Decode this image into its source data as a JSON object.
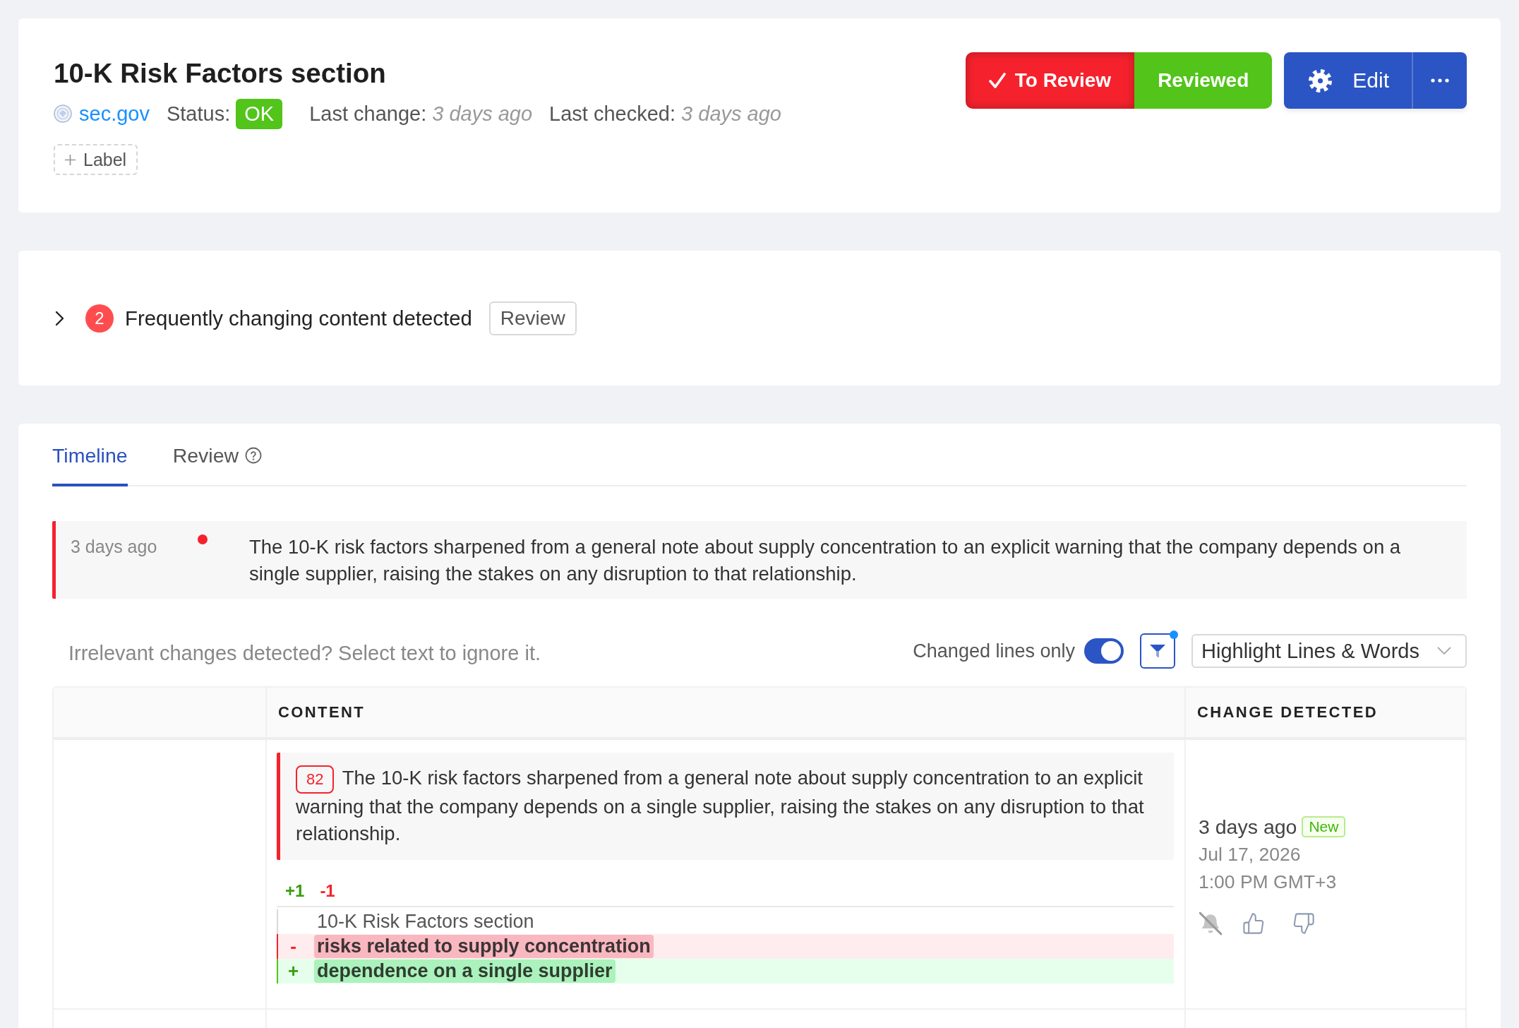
{
  "header": {
    "title": "10-K Risk Factors section",
    "source": "sec.gov",
    "status_label": "Status:",
    "status": "OK",
    "last_change_label": "Last change:",
    "last_change": "3 days ago",
    "last_checked_label": "Last checked:",
    "last_checked": "3 days ago",
    "add_label": "Label",
    "review_states": [
      {
        "label": "To Review",
        "selected": true,
        "color": "#f5222d"
      },
      {
        "label": "Reviewed",
        "selected": false,
        "color": "#52c41a"
      }
    ],
    "edit_button": "Edit"
  },
  "alert": {
    "expanded": false,
    "count": "2",
    "text": "Frequently changing content detected",
    "button": "Review"
  },
  "tabs": [
    {
      "label": "Timeline",
      "selected": true,
      "help": false
    },
    {
      "label": "Review",
      "selected": false,
      "help": true
    }
  ],
  "timeline": [
    {
      "time": "3 days ago",
      "selected": true,
      "unread": true,
      "summary": "The 10-K risk factors sharpened from a general note about supply concentration to an explicit warning that the company depends on a single supplier, raising the stakes on any disruption to that relationship."
    }
  ],
  "controls": {
    "hint": "Irrelevant changes detected? Select text to ignore it.",
    "changed_lines_only": {
      "label": "Changed lines only",
      "on": true
    },
    "filter": {
      "active": true
    },
    "highlight_mode": "Highlight Lines & Words"
  },
  "table": {
    "columns": [
      "CONTENT",
      "CHANGE DETECTED"
    ],
    "rows": [
      {
        "excerpt_number": "82",
        "excerpt": "The 10-K risk factors sharpened from a general note about supply concentration to an explicit warning that the company depends on a single supplier, raising the stakes on any disruption to that relationship.",
        "added_count": "+1",
        "removed_count": "-1",
        "diff": [
          {
            "kind": "context",
            "text": "10-K Risk Factors section"
          },
          {
            "kind": "removed",
            "sign": "-",
            "text": "risks related to supply concentration"
          },
          {
            "kind": "added",
            "sign": "+",
            "text": "dependence on a single supplier"
          }
        ],
        "detected": "3 days ago",
        "tag": "New",
        "date": "Jul 17, 2026",
        "time": "1:00 PM GMT+3",
        "notifications_muted": true
      }
    ]
  }
}
